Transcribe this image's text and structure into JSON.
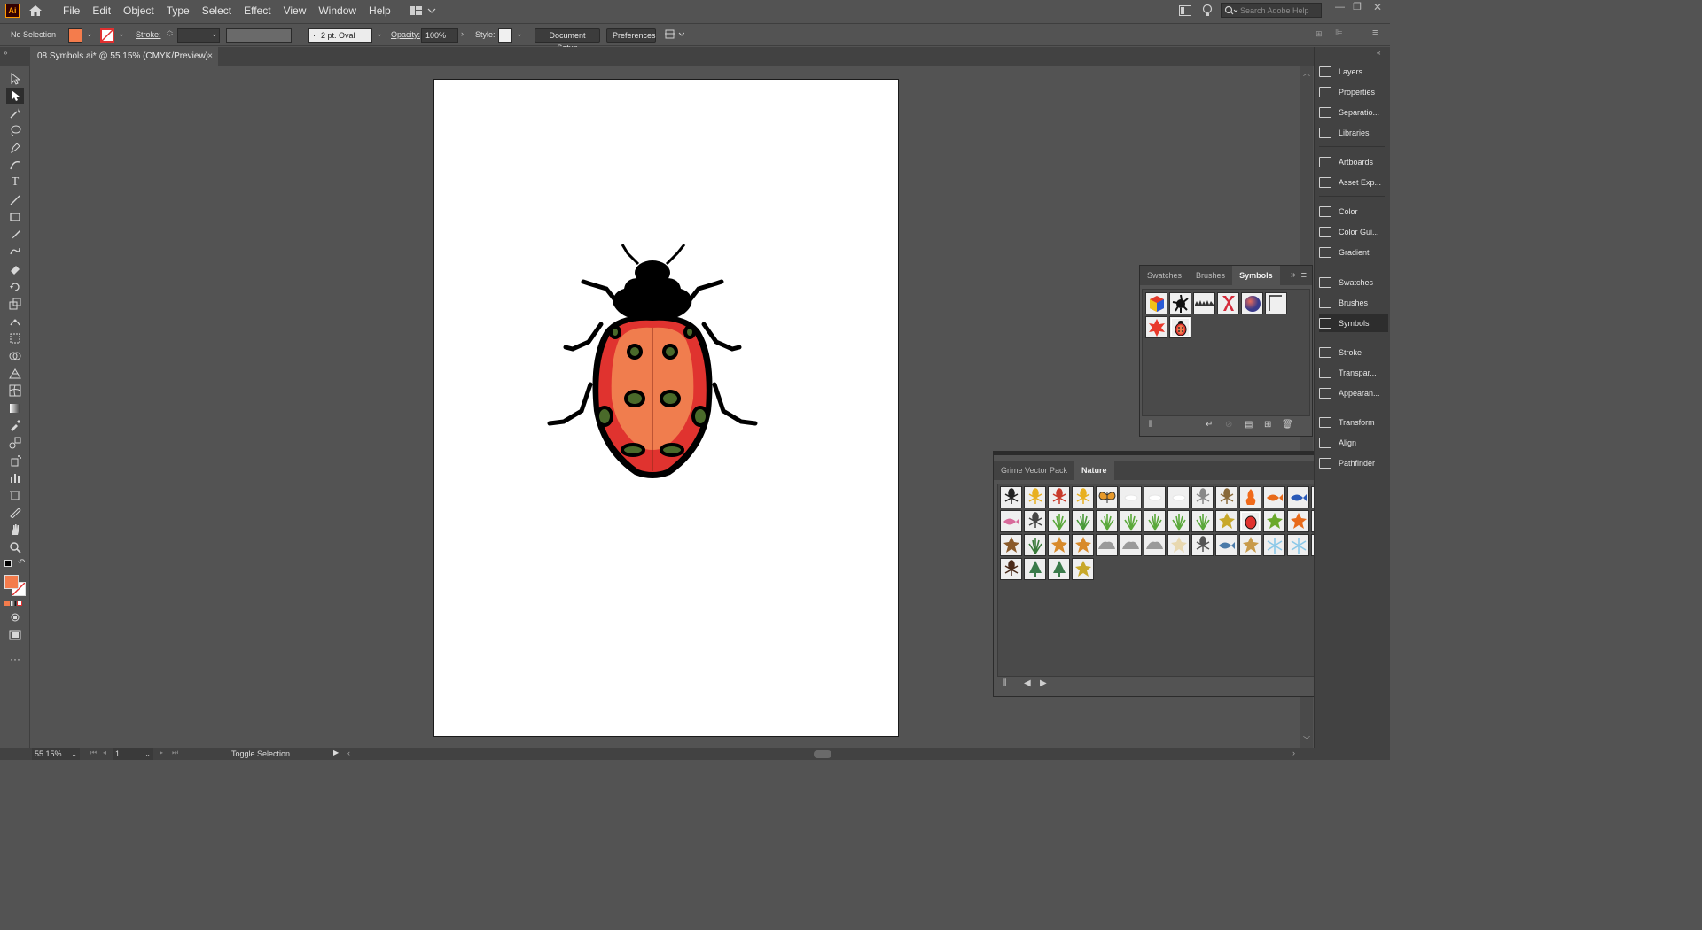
{
  "app": {
    "logo_text": "Ai"
  },
  "menu": [
    "File",
    "Edit",
    "Object",
    "Type",
    "Select",
    "Effect",
    "View",
    "Window",
    "Help"
  ],
  "search": {
    "placeholder": "Search Adobe Help"
  },
  "control_bar": {
    "selection": "No Selection",
    "stroke_label": "Stroke:",
    "brush": "2 pt. Oval",
    "opacity_label": "Opacity:",
    "opacity_value": "100%",
    "style_label": "Style:",
    "document_setup": "Document Setup",
    "preferences": "Preferences",
    "fill_color": "#f47c4c"
  },
  "document_tab": {
    "title": "08 Symbols.ai* @ 55.15% (CMYK/Preview)",
    "close": "×"
  },
  "dock": {
    "items": [
      "Layers",
      "Properties",
      "Separatio...",
      "Libraries",
      "Artboards",
      "Asset Exp...",
      "Color",
      "Color Gui...",
      "Gradient",
      "Swatches",
      "Brushes",
      "Symbols",
      "Stroke",
      "Transpar...",
      "Appearan...",
      "Transform",
      "Align",
      "Pathfinder"
    ],
    "pathfinder_visible": "finder",
    "last_visible": "n"
  },
  "symbols_panel": {
    "tabs": [
      "Swatches",
      "Brushes",
      "Symbols"
    ],
    "active_tab": "Symbols",
    "items": [
      "cube",
      "splat",
      "grass-strip",
      "ribbon",
      "sphere",
      "banner",
      "flower",
      "ladybug"
    ]
  },
  "nature_panel": {
    "tabs": [
      "Grime Vector Pack",
      "Nature"
    ],
    "active_tab": "Nature",
    "rows": [
      [
        "ant",
        "bee",
        "spider-red",
        "beetle",
        "butterfly",
        "cloud1",
        "cloud2",
        "cloud3",
        "dragonfly",
        "feather",
        "fire",
        "fish-orange",
        "fish-blue",
        "fish-green"
      ],
      [
        "fish-pink",
        "fly",
        "grass1",
        "plant",
        "grass2",
        "grass3",
        "grass4",
        "grass5",
        "grass6",
        "leaf-yellow",
        "ladybug",
        "leaf-green",
        "leaf-orange",
        "leaf-maple"
      ],
      [
        "leaf-brown",
        "fern",
        "leaf1",
        "leaf2",
        "rock1",
        "rock2",
        "rock3",
        "seed",
        "scorpion",
        "shark",
        "shell",
        "snowflake1",
        "snowflake2",
        "spider-blue"
      ],
      [
        "spider",
        "tree",
        "tree2",
        "leaf-gold"
      ]
    ]
  },
  "status_bar": {
    "zoom": "55.15%",
    "page": "1",
    "mode": "Toggle Selection"
  },
  "colors": {
    "ladybug_red": "#e0332f",
    "ladybug_orange": "#f07d4e",
    "spot_green": "#4a6a2a",
    "accent_fill": "#f47c4c"
  }
}
